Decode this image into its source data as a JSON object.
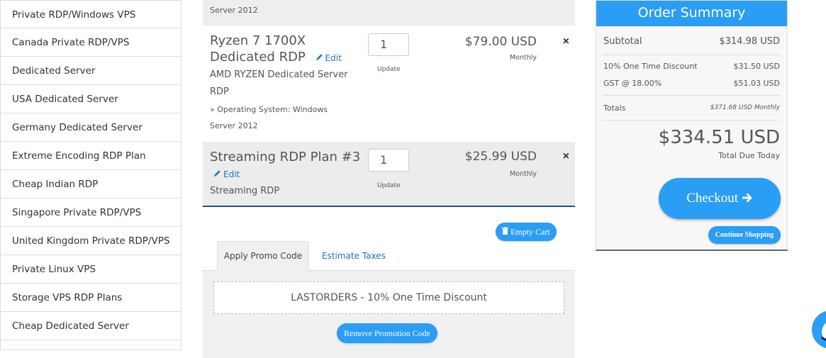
{
  "sidebar": {
    "items": [
      "Private RDP/Windows VPS",
      "Canada Private RDP/VPS",
      "Dedicated Server",
      "USA Dedicated Server",
      "Germany Dedicated Server",
      "Extreme Encoding RDP Plan",
      "Cheap Indian RDP",
      "Singapore Private RDP/VPS",
      "United Kingdom Private RDP/VPS",
      "Private Linux VPS",
      "Storage VPS RDP Plans",
      "Cheap Dedicated Server"
    ]
  },
  "cart": {
    "top_strip_text": "Server 2012",
    "items": [
      {
        "title_line1": "Ryzen 7 1700X",
        "title_line2": "Dedicated RDP",
        "edit_label": "Edit",
        "desc_line1": "AMD RYZEN Dedicated Server",
        "desc_line2": "RDP",
        "option_line1": "» Operating System: Windows",
        "option_line2": "Server 2012",
        "quantity": "1",
        "update_label": "Update",
        "price": "$79.00 USD",
        "cycle": "Monthly",
        "remove_symbol": "×"
      },
      {
        "title_line1": "Streaming RDP Plan #3",
        "edit_label": "Edit",
        "desc_line1": "Streaming RDP",
        "quantity": "1",
        "update_label": "Update",
        "price": "$25.99 USD",
        "cycle": "Monthly",
        "remove_symbol": "×"
      }
    ],
    "empty_cart_label": "Empty Cart",
    "tabs": [
      "Apply Promo Code",
      "Estimate Taxes"
    ],
    "promo_text": "LASTORDERS - 10% One Time Discount",
    "remove_promo_label": "Remove Promotion Code"
  },
  "summary": {
    "title": "Order Summary",
    "subtotal_label": "Subtotal",
    "subtotal_value": "$314.98 USD",
    "discount_label": "10% One Time Discount",
    "discount_value": "$31.50 USD",
    "tax_label": "GST @ 18.00%",
    "tax_value": "$51.03 USD",
    "totals_label": "Totals",
    "totals_value": "$371.68 USD Monthly",
    "total_due": "$334.51 USD",
    "total_due_label": "Total Due Today",
    "checkout_label": "Checkout",
    "continue_label": "Continue Shopping"
  },
  "colors": {
    "accent": "#2a9df4",
    "link": "#1e73be",
    "divider_blue": "#1f4e8c"
  }
}
